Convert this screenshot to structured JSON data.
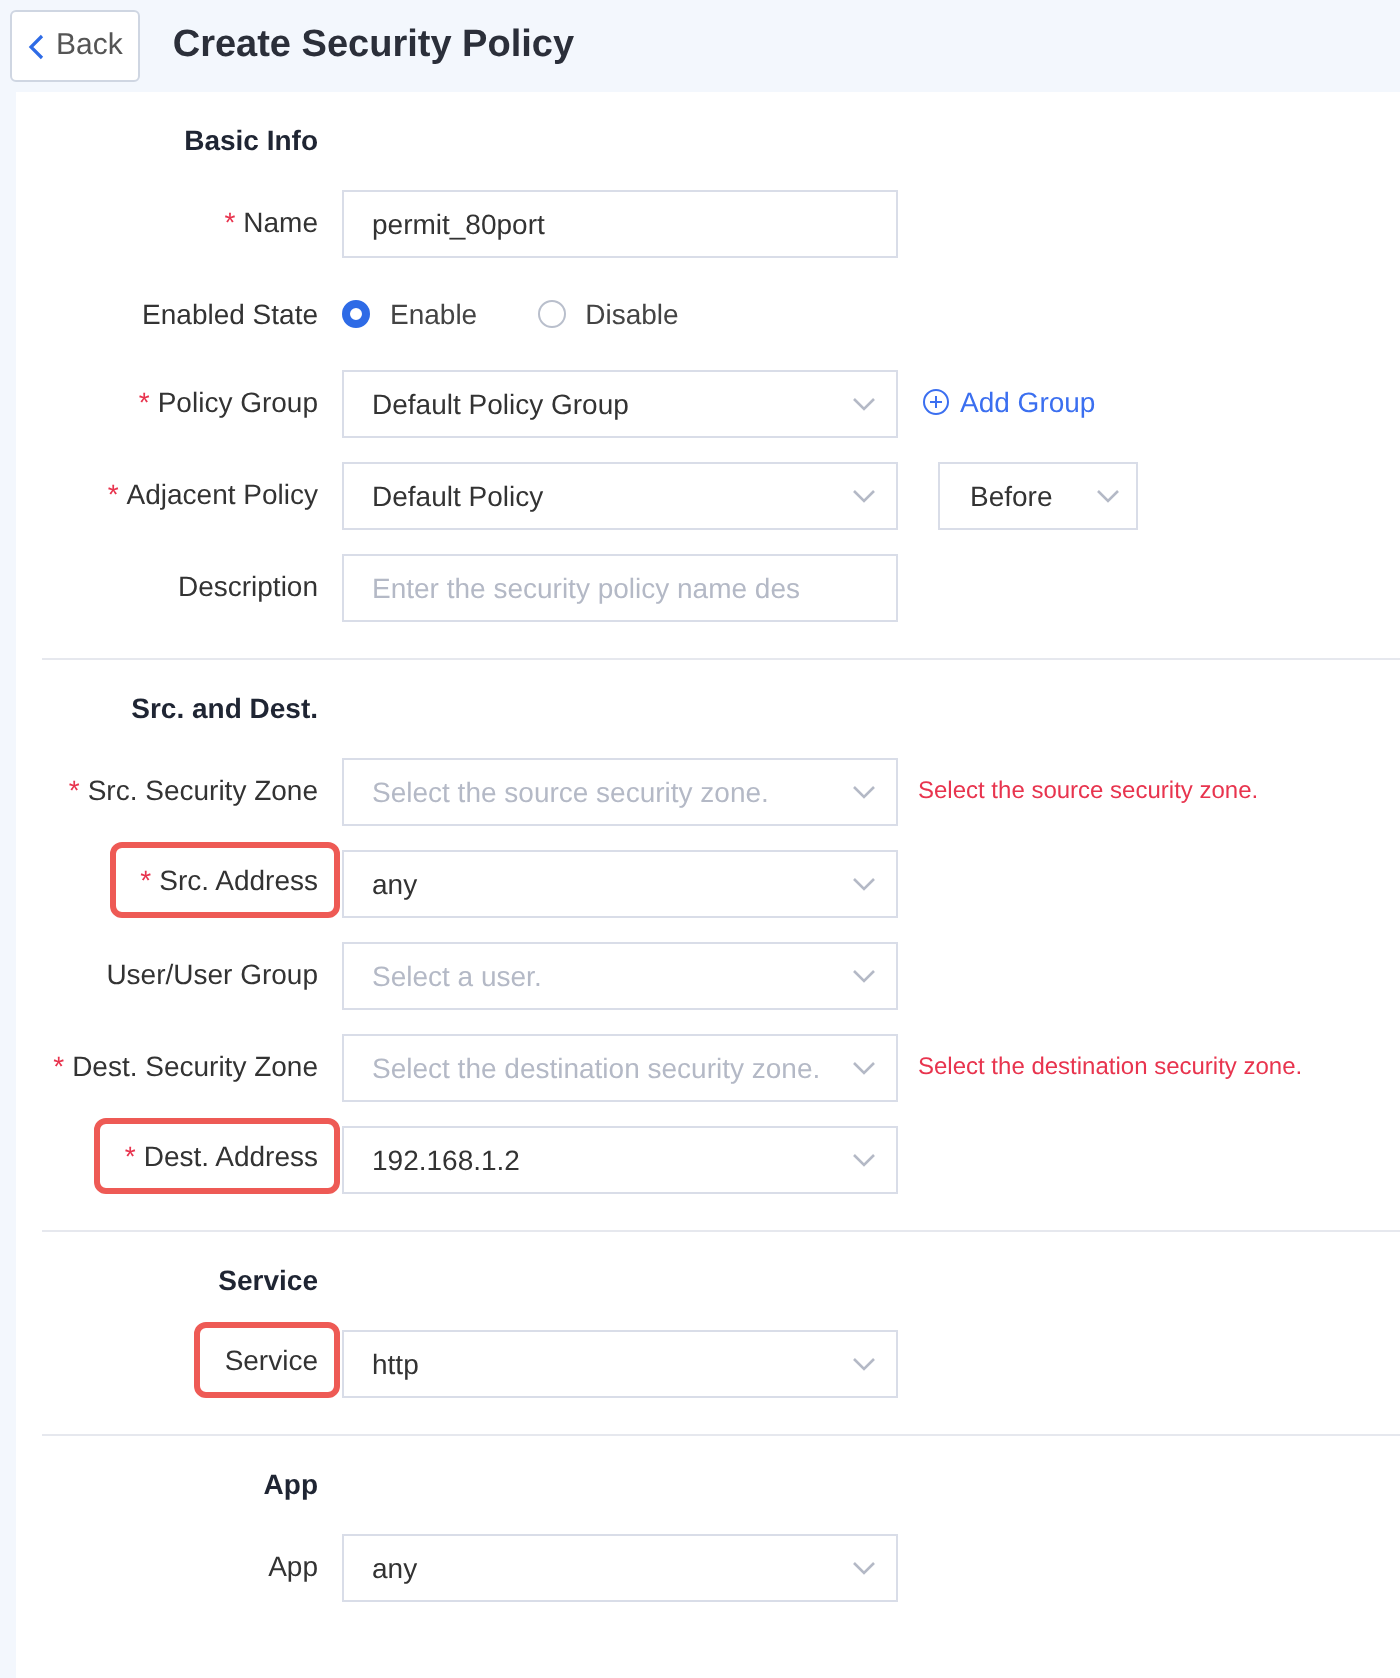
{
  "header": {
    "back_label": "Back",
    "title": "Create Security Policy"
  },
  "sections": [
    {
      "title": "Basic Info",
      "fields": [
        {
          "kind": "text",
          "label": "Name",
          "required_mark": "*",
          "highlighted": false,
          "value": "permit_80port"
        },
        {
          "kind": "radio",
          "label": "Enabled State",
          "highlighted": false,
          "options": [
            {
              "label": "Enable",
              "selected": true
            },
            {
              "label": "Disable",
              "selected": false
            }
          ]
        },
        {
          "kind": "select",
          "label": "Policy Group",
          "required_mark": "*",
          "highlighted": false,
          "value": "Default Policy Group",
          "link": "Add Group"
        },
        {
          "kind": "select",
          "label": "Adjacent Policy",
          "required_mark": "*",
          "highlighted": false,
          "value": "Default Policy",
          "extra_select": "Before"
        },
        {
          "kind": "text",
          "label": "Description",
          "highlighted": false,
          "placeholder": "Enter the security policy name des"
        }
      ]
    },
    {
      "title": "Src. and Dest.",
      "fields": [
        {
          "kind": "select",
          "label": "Src. Security Zone",
          "required_mark": "*",
          "highlighted": false,
          "placeholder": "Select the source security zone.",
          "error": "Select the source security zone."
        },
        {
          "kind": "select",
          "label": "Src. Address",
          "required_mark": "*",
          "highlighted": true,
          "value": "any"
        },
        {
          "kind": "select",
          "label": "User/User Group",
          "highlighted": false,
          "placeholder": "Select a user."
        },
        {
          "kind": "select",
          "label": "Dest. Security Zone",
          "required_mark": "*",
          "highlighted": false,
          "placeholder": "Select the destination security zone.",
          "error": "Select the destination security zone."
        },
        {
          "kind": "select",
          "label": "Dest. Address",
          "required_mark": "*",
          "highlighted": true,
          "value": "192.168.1.2"
        }
      ]
    },
    {
      "title": "Service",
      "fields": [
        {
          "kind": "select",
          "label": "Service",
          "highlighted": true,
          "value": "http"
        }
      ]
    },
    {
      "title": "App",
      "fields": [
        {
          "kind": "select",
          "label": "App",
          "highlighted": false,
          "value": "any"
        }
      ]
    }
  ]
}
